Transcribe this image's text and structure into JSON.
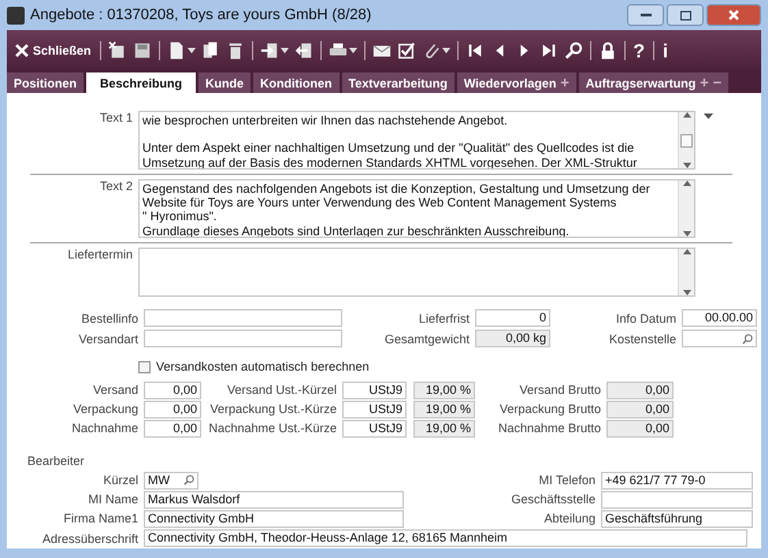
{
  "window": {
    "title": "Angebote : 01370208, Toys are yours GmbH (8/28)"
  },
  "toolbar": {
    "close_label": "Schließen",
    "glyph_buttons": [
      "?",
      "i"
    ]
  },
  "tabs": [
    {
      "label": "Positionen",
      "selected": false
    },
    {
      "label": "Beschreibung",
      "selected": true
    },
    {
      "label": "Kunde",
      "selected": false
    },
    {
      "label": "Konditionen",
      "selected": false
    },
    {
      "label": "Textverarbeitung",
      "selected": false
    },
    {
      "label": "Wiedervorlagen",
      "selected": false,
      "actions": [
        "+"
      ]
    },
    {
      "label": "Auftragserwartung",
      "selected": false,
      "actions": [
        "+",
        "−"
      ]
    }
  ],
  "texts": [
    {
      "label": "Text 1",
      "paragraphs": [
        [
          "wie besprochen unterbreiten wir Ihnen das nachstehende Angebot."
        ],
        [
          "Unter dem Aspekt einer nachhaltigen Umsetzung und der \"Qualität\" des Quellcodes ist die",
          "Umsetzung auf der Basis des modernen Standards XHTML vorgesehen. Der XML-Struktur"
        ]
      ]
    },
    {
      "label": "Text 2",
      "paragraphs": [
        [
          "Gegenstand des nachfolgenden Angebots ist die Konzeption, Gestaltung und Umsetzung der",
          "Website für Toys are Yours unter Verwendung des Web Content Management Systems",
          "\" Hyronimus\".",
          "Grundlage dieses Angebots sind Unterlagen zur beschränkten Ausschreibung."
        ]
      ]
    },
    {
      "label": "Liefertermin"
    }
  ],
  "order_rows": [
    [
      {
        "label": "Bestellinfo",
        "kind": "text",
        "disabled": false
      },
      {
        "label": "Lieferfrist",
        "value": "0",
        "kind": "number",
        "disabled": false
      },
      {
        "label": "Info Datum",
        "value": "00.00.00",
        "kind": "number",
        "disabled": false
      }
    ],
    [
      {
        "label": "Versandart",
        "kind": "text",
        "disabled": false
      },
      {
        "label": "Gesamtgewicht",
        "value": "0,00 kg",
        "kind": "number",
        "disabled": true
      },
      {
        "label": "Kostenstelle",
        "kind": "lookup",
        "disabled": false
      }
    ]
  ],
  "shipping_checkbox": {
    "label": "Versandkosten automatisch berechnen",
    "checked": false
  },
  "cost_rows": [
    {
      "amount": {
        "label": "Versand",
        "value": "0,00"
      },
      "tax": {
        "label": "Versand Ust.-Kürzel",
        "code": "UStJ9",
        "rate": "19,00 %"
      },
      "gross": {
        "label": "Versand Brutto",
        "value": "0,00"
      }
    },
    {
      "amount": {
        "label": "Verpackung",
        "value": "0,00"
      },
      "tax": {
        "label": "Verpackung Ust.-Kürze",
        "code": "UStJ9",
        "rate": "19,00 %"
      },
      "gross": {
        "label": "Verpackung Brutto",
        "value": "0,00"
      }
    },
    {
      "amount": {
        "label": "Nachnahme",
        "value": "0,00"
      },
      "tax": {
        "label": "Nachnahme Ust.-Kürze",
        "code": "UStJ9",
        "rate": "19,00 %"
      },
      "gross": {
        "label": "Nachnahme Brutto",
        "value": "0,00"
      }
    }
  ],
  "editor": {
    "heading": "Bearbeiter",
    "rows": [
      {
        "left": {
          "label": "Kürzel",
          "value": "MW",
          "kind": "lookup"
        },
        "right": {
          "label": "MI Telefon",
          "value": "+49 621/7 77 79-0"
        }
      },
      {
        "left": {
          "label": "MI Name",
          "value": "Markus Walsdorf",
          "kind": "text"
        },
        "right": {
          "label": "Geschäftsstelle"
        }
      },
      {
        "left": {
          "label": "Firma Name1",
          "value": "Connectivity GmbH",
          "kind": "text"
        },
        "right": {
          "label": "Abteilung",
          "value": "Geschäftsführung"
        }
      }
    ],
    "address": {
      "label": "Adressüberschrift",
      "value": "Connectivity GmbH, Theodor-Heuss-Anlage 12, 68165 Mannheim"
    }
  }
}
